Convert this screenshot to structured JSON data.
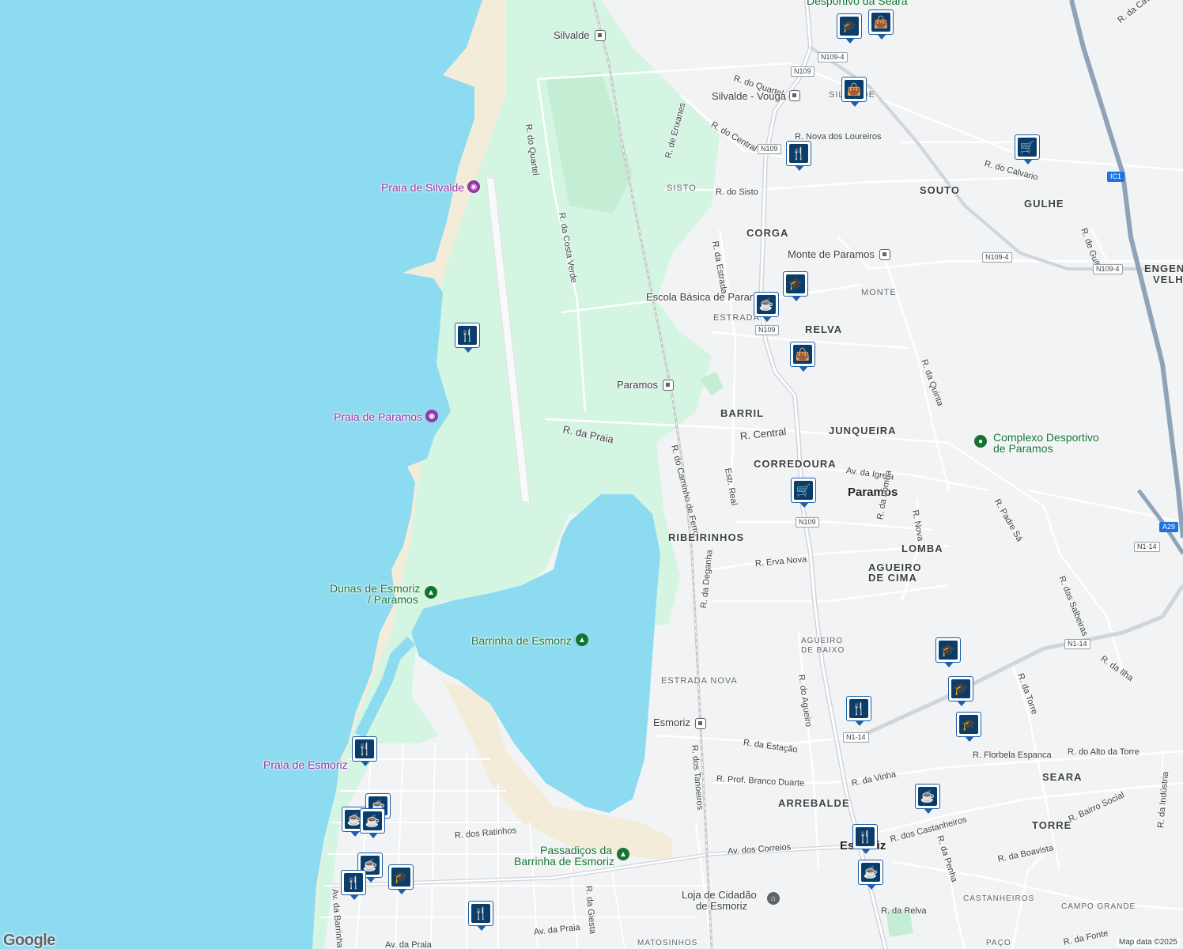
{
  "colors": {
    "water": "#8ddbf0",
    "park": "#d4f5e1",
    "park_dark": "#c3eed3",
    "sand": "#f3ecd9",
    "land": "#f1f3f4",
    "road": "#ffffff",
    "highway": "#9aa9b8",
    "rail": "#c7c9cc",
    "marker": "#0b3d6b",
    "purple": "#9334a6",
    "green": "#137333"
  },
  "labels": {
    "silvalde": "Silvalde",
    "silvalde_vouga": "Silvalde - Vouga",
    "r_quartel1": "R. do Quartel",
    "r_quartel2": "R. do Quartel",
    "r_central1": "R. do Central",
    "r_nova_loureiros": "R. Nova dos Loureiros",
    "r_enxanes": "R. de Enxanes",
    "sisto": "SISTO",
    "r_sisto": "R. do Sisto",
    "souto": "SOUTO",
    "gulhe": "GULHE",
    "r_calvario": "R. do Calvario",
    "r_gulhe": "R. de Gulhe",
    "engen": "ENGEN",
    "velh": "VELH",
    "corga": "CORGA",
    "monte_paramos": "Monte de Paramos",
    "monte": "MONTE",
    "r_estrada": "R. da Estrada",
    "escola": "Escola Básica de Paramos",
    "estrada": "ESTRADA",
    "relva": "RELVA",
    "praia_silvalde": "Praia de Silvalde",
    "r_costa_verde": "R. da Costa Verde",
    "praia_paramos": "Praia de Paramos",
    "paramos_station": "Paramos",
    "barril": "BARRIL",
    "r_praia": "R. da Praia",
    "r_central": "R. Central",
    "junqueira": "JUNQUEIRA",
    "complexo": "Complexo Desportivo",
    "complexo2": "de Paramos",
    "r_quinta": "R. da Quinta",
    "corredoura": "CORREDOURA",
    "av_igreja": "Av. da Igreja",
    "paramos_town": "Paramos",
    "r_caminho_ferro": "R. do Caminho de Ferro",
    "estr_real": "Estr. Real",
    "r_padre_sa": "R. Padre Sá",
    "r_lomba": "R. da Lomba",
    "r_nova": "R. Nova",
    "lomba": "LOMBA",
    "ribeirinhos": "RIBEIRINHOS",
    "r_erva_nova": "R. Erva Nova",
    "agueiro_cima": "AGUEIRO",
    "agueiro_cima2": "DE CIMA",
    "r_deganha": "R. da Deganha",
    "r_salbeiras": "R. das Salbeiras",
    "dunas": "Dunas de Esmoriz",
    "dunas2": "/ Paramos",
    "barrinha": "Barrinha de Esmoriz",
    "agueiro_baixo": "AGUEIRO",
    "agueiro_baixo2": "DE BAIXO",
    "r_ilha": "R. da Ilha",
    "r_torre": "R. da Torre",
    "estrada_nova": "ESTRADA NOVA",
    "r_agueiro": "R. do Agueiro",
    "esmoriz_station": "Esmoriz",
    "r_estacao": "R. da Estação",
    "r_tanoeiros": "R. dos Tanoeiros",
    "praia_esmoriz": "Praia de Esmoriz",
    "r_florbela": "R. Florbela Espanca",
    "r_alto_torre": "R. do Alto da Torre",
    "seara": "SEARA",
    "r_prof": "R. Prof. Branco Duarte",
    "r_vinha": "R. da Vinha",
    "arrebalde": "ARREBALDE",
    "r_castanheiros": "R. dos Castanheiros",
    "r_bairro_social": "R. Bairro Social",
    "r_industria": "R. da Indústria",
    "torre": "TORRE",
    "r_penha": "R. da Penha",
    "r_ratinhos": "R. dos Ratinhos",
    "passadicos": "Passadiços da",
    "passadicos2": "Barrinha de Esmoriz",
    "av_correios": "Av. dos Correios",
    "esmoriz_town": "Esmoriz",
    "r_boavista": "R. da Boavista",
    "r_giesta": "R. da Giesta",
    "loja": "Loja de Cidadão",
    "loja2": "de Esmoriz",
    "castanheiros": "CASTANHEIROS",
    "campo_grande": "CAMPO GRANDE",
    "r_relva": "R. da Relva",
    "av_barrinha": "Av. da Barrinha",
    "av_praia1": "Av. da Praia",
    "av_praia2": "Av. da Praia",
    "matosinhos": "MATOSINHOS",
    "r_fonte": "R. da Fonte",
    "paco": "PAÇO",
    "desportivo_seara": "Desportivo da Seara",
    "r_cavada": "R. da Cavada Ve"
  },
  "shields": {
    "n109_4a": "N109-4",
    "n109a": "N109",
    "n109b": "N109",
    "n109c": "N109",
    "n109d": "N109",
    "n109_4b": "N109-4",
    "n109_4c": "N109-4",
    "ic1": "IC1",
    "a29": "A29",
    "n1_14a": "N1-14",
    "n1_14b": "N1-14",
    "n1_14c": "N1-14"
  },
  "markers": {
    "school": "school-icon",
    "shop": "shopping-bag-icon",
    "cart": "shopping-cart-icon",
    "food": "restaurant-icon",
    "cafe": "cafe-icon"
  },
  "google": "Google",
  "attribution": "Map data ©2025"
}
